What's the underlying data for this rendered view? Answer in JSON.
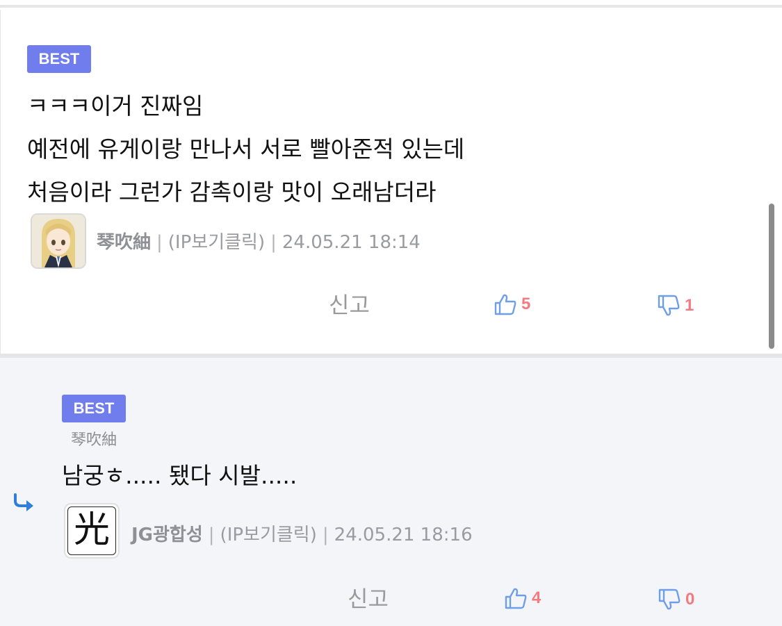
{
  "comments": [
    {
      "badge": "BEST",
      "lines": [
        "ㅋㅋㅋ이거 진짜임",
        "예전에 유게이랑 만나서 서로 빨아준적 있는데",
        "처음이라 그런가 감촉이랑 맛이 오래남더라"
      ],
      "author": "琴吹紬",
      "ip": "(IP보기클릭)",
      "date": "24.05.21 18:14",
      "report": "신고",
      "likes": "5",
      "dislikes": "1",
      "avatar_icon": "anime-girl-avatar"
    },
    {
      "badge": "BEST",
      "reply_to": "琴吹紬",
      "lines": [
        "남궁ㅎ..... 됐다 시발....."
      ],
      "author": "JG광합성",
      "ip": "(IP보기클릭)",
      "date": "24.05.21 18:16",
      "report": "신고",
      "likes": "4",
      "dislikes": "0",
      "avatar_glyph": "光"
    }
  ],
  "colors": {
    "badge": "#6f7ded",
    "count": "#f47a82",
    "thumb": "#6f9ee8",
    "reply_bg": "#f4f5f8",
    "reply_arrow": "#2f7fd8"
  }
}
